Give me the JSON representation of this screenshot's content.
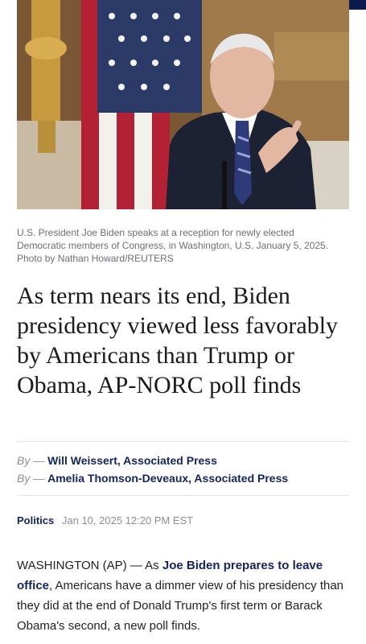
{
  "photo": {
    "colors": {
      "flag_red": "#b22234",
      "flag_blue": "#2b3a67",
      "suit": "#1c2233",
      "background": "#a07a4b"
    }
  },
  "caption": {
    "line1": "U.S. President Joe Biden speaks at a reception for newly elected",
    "line2": "Democratic members of Congress, in Washington, U.S. January 5, 2025.",
    "line3": "Photo by Nathan Howard/REUTERS"
  },
  "headline": "As term nears its end, Biden presidency viewed less favorably by Americans than Trump or Obama, AP-NORC poll finds",
  "bylines": [
    {
      "prefix": "By —",
      "author": "Will Weissert, Associated Press"
    },
    {
      "prefix": "By —",
      "author": "Amelia Thomson-Deveaux, Associated Press"
    }
  ],
  "meta": {
    "section": "Politics",
    "date": "Jan 10, 2025 12:20 PM EST"
  },
  "body": {
    "dateline": "WASHINGTON (AP) — As ",
    "link": "Joe Biden prepares to leave office",
    "rest": ", Americans have a dimmer view of his presidency than they did at the end of Donald Trump's first term or Barack Obama's second, a new poll finds."
  },
  "colors": {
    "link": "#14255c",
    "muted": "#8a8f98"
  }
}
